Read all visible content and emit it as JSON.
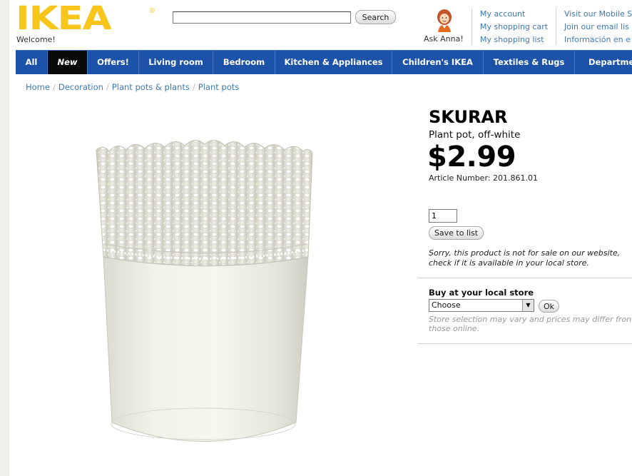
{
  "header": {
    "logo": "IKEA",
    "logo_reg": "®",
    "welcome": "Welcome!",
    "search": {
      "value": "",
      "placeholder": "",
      "button_label": "Search"
    },
    "ask_anna": "Ask Anna!",
    "account_links": [
      "My account",
      "My shopping cart",
      "My shopping list"
    ],
    "extra_links": [
      "Visit our Mobile S",
      "Join our email lis",
      "Información en e"
    ],
    "colors": {
      "logo_yellow": "#f7c51c",
      "nav_blue": "#1c53a8",
      "link_blue": "#3b79b6"
    }
  },
  "nav": {
    "items": [
      "All",
      "New",
      "Offers!",
      "Living room",
      "Bedroom",
      "Kitchen & Appliances",
      "Children's IKEA",
      "Textiles & Rugs",
      "Departme"
    ]
  },
  "breadcrumb": [
    "Home",
    "Decoration",
    "Plant pots & plants",
    "Plant pots"
  ],
  "product": {
    "name": "SKURAR",
    "description": "Plant pot, off-white",
    "price": "$2.99",
    "article": "Article Number: 201.861.01",
    "quantity": "1",
    "save_label": "Save to list",
    "not_for_sale": "Sorry, this product is not for sale on our website, check if it is available in your local store.",
    "image_icon": "plant-pot-image"
  },
  "store": {
    "title": "Buy at your local store",
    "selected": "Choose",
    "ok_label": "Ok",
    "note": "Store selection may vary and prices may differ fron those online."
  }
}
